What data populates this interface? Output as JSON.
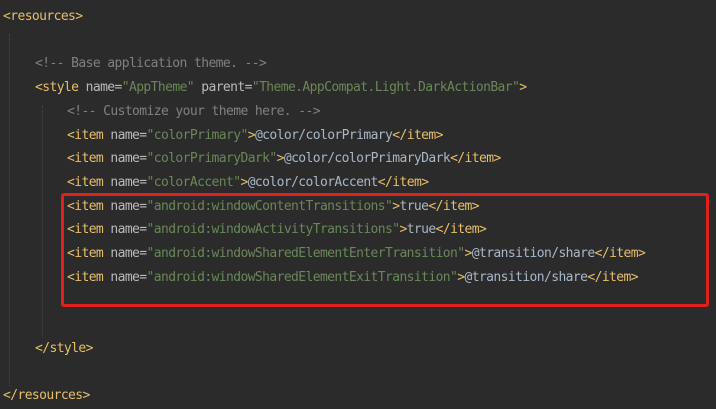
{
  "colors": {
    "background": "#2b2b2b",
    "tag": "#e8bf6a",
    "attribute": "#bababa",
    "value": "#6a8759",
    "text": "#a9b7c6",
    "comment": "#808080",
    "highlight_box": "#e0201d"
  },
  "editor": {
    "lines": [
      {
        "indent": 0,
        "tokens": [
          {
            "k": "punct",
            "t": "<"
          },
          {
            "k": "tag",
            "t": "resources"
          },
          {
            "k": "punct",
            "t": ">"
          }
        ]
      },
      {
        "indent": 0,
        "tokens": []
      },
      {
        "indent": 1,
        "tokens": [
          {
            "k": "comment",
            "t": "<!-- Base application theme. -->"
          }
        ]
      },
      {
        "indent": 1,
        "tokens": [
          {
            "k": "punct",
            "t": "<"
          },
          {
            "k": "tag",
            "t": "style "
          },
          {
            "k": "attr",
            "t": "name="
          },
          {
            "k": "val",
            "t": "\"AppTheme\" "
          },
          {
            "k": "attr",
            "t": "parent="
          },
          {
            "k": "val",
            "t": "\"Theme.AppCompat.Light.DarkActionBar\""
          },
          {
            "k": "punct",
            "t": ">"
          }
        ]
      },
      {
        "indent": 2,
        "tokens": [
          {
            "k": "comment",
            "t": "<!-- Customize your theme here. -->"
          }
        ]
      },
      {
        "indent": 2,
        "tokens": [
          {
            "k": "punct",
            "t": "<"
          },
          {
            "k": "tag",
            "t": "item "
          },
          {
            "k": "attr",
            "t": "name="
          },
          {
            "k": "val",
            "t": "\"colorPrimary\""
          },
          {
            "k": "punct",
            "t": ">"
          },
          {
            "k": "text",
            "t": "@color/colorPrimary"
          },
          {
            "k": "punct",
            "t": "</"
          },
          {
            "k": "tag",
            "t": "item"
          },
          {
            "k": "punct",
            "t": ">"
          }
        ]
      },
      {
        "indent": 2,
        "tokens": [
          {
            "k": "punct",
            "t": "<"
          },
          {
            "k": "tag",
            "t": "item "
          },
          {
            "k": "attr",
            "t": "name="
          },
          {
            "k": "val",
            "t": "\"colorPrimaryDark\""
          },
          {
            "k": "punct",
            "t": ">"
          },
          {
            "k": "text",
            "t": "@color/colorPrimaryDark"
          },
          {
            "k": "punct",
            "t": "</"
          },
          {
            "k": "tag",
            "t": "item"
          },
          {
            "k": "punct",
            "t": ">"
          }
        ]
      },
      {
        "indent": 2,
        "tokens": [
          {
            "k": "punct",
            "t": "<"
          },
          {
            "k": "tag",
            "t": "item "
          },
          {
            "k": "attr",
            "t": "name="
          },
          {
            "k": "val",
            "t": "\"colorAccent\""
          },
          {
            "k": "punct",
            "t": ">"
          },
          {
            "k": "text",
            "t": "@color/colorAccent"
          },
          {
            "k": "punct",
            "t": "</"
          },
          {
            "k": "tag",
            "t": "item"
          },
          {
            "k": "punct",
            "t": ">"
          }
        ]
      },
      {
        "indent": 2,
        "tokens": [
          {
            "k": "punct",
            "t": "<"
          },
          {
            "k": "tag",
            "t": "item "
          },
          {
            "k": "attr",
            "t": "name="
          },
          {
            "k": "val",
            "t": "\"android:windowContentTransitions\""
          },
          {
            "k": "punct",
            "t": ">"
          },
          {
            "k": "text",
            "t": "true"
          },
          {
            "k": "punct",
            "t": "</"
          },
          {
            "k": "tag",
            "t": "item"
          },
          {
            "k": "punct",
            "t": ">"
          }
        ]
      },
      {
        "indent": 2,
        "tokens": [
          {
            "k": "punct",
            "t": "<"
          },
          {
            "k": "tag",
            "t": "item "
          },
          {
            "k": "attr",
            "t": "name="
          },
          {
            "k": "val",
            "t": "\"android:windowActivityTransitions\""
          },
          {
            "k": "punct",
            "t": ">"
          },
          {
            "k": "text",
            "t": "true"
          },
          {
            "k": "punct",
            "t": "</"
          },
          {
            "k": "tag",
            "t": "item"
          },
          {
            "k": "punct",
            "t": ">"
          }
        ]
      },
      {
        "indent": 2,
        "tokens": [
          {
            "k": "punct",
            "t": "<"
          },
          {
            "k": "tag",
            "t": "item "
          },
          {
            "k": "attr",
            "t": "name="
          },
          {
            "k": "val",
            "t": "\"android:windowSharedElementEnterTransition\""
          },
          {
            "k": "punct",
            "t": ">"
          },
          {
            "k": "text",
            "t": "@transition/share"
          },
          {
            "k": "punct",
            "t": "</"
          },
          {
            "k": "tag",
            "t": "item"
          },
          {
            "k": "punct",
            "t": ">"
          }
        ]
      },
      {
        "indent": 2,
        "tokens": [
          {
            "k": "punct",
            "t": "<"
          },
          {
            "k": "tag",
            "t": "item "
          },
          {
            "k": "attr",
            "t": "name="
          },
          {
            "k": "val",
            "t": "\"android:windowSharedElementExitTransition\""
          },
          {
            "k": "punct",
            "t": ">"
          },
          {
            "k": "text",
            "t": "@transition/share"
          },
          {
            "k": "punct",
            "t": "</"
          },
          {
            "k": "tag",
            "t": "item"
          },
          {
            "k": "punct",
            "t": ">"
          }
        ]
      },
      {
        "indent": 0,
        "tokens": []
      },
      {
        "indent": 0,
        "tokens": []
      },
      {
        "indent": 1,
        "tokens": [
          {
            "k": "punct",
            "t": "</"
          },
          {
            "k": "tag",
            "t": "style"
          },
          {
            "k": "punct",
            "t": ">"
          }
        ]
      },
      {
        "indent": 0,
        "tokens": []
      },
      {
        "indent": 0,
        "tokens": [
          {
            "k": "punct",
            "t": "</"
          },
          {
            "k": "tag",
            "t": "resources"
          },
          {
            "k": "punct",
            "t": ">"
          }
        ]
      }
    ]
  }
}
